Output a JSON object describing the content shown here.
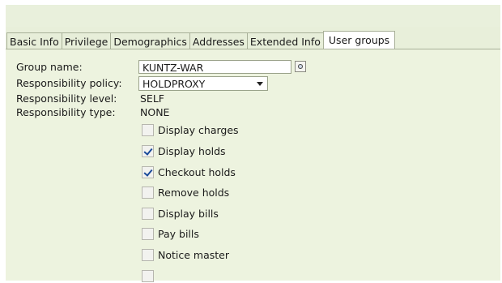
{
  "tabs": [
    {
      "label": "Basic Info",
      "active": false
    },
    {
      "label": "Privilege",
      "active": false
    },
    {
      "label": "Demographics",
      "active": false
    },
    {
      "label": "Addresses",
      "active": false
    },
    {
      "label": "Extended Info",
      "active": false
    },
    {
      "label": "User groups",
      "active": true
    }
  ],
  "form": {
    "group_name_label": "Group name:",
    "group_name_value": "KUNTZ-WAR",
    "policy_label": "Responsibility policy:",
    "policy_value": "HOLDPROXY",
    "level_label": "Responsibility level:",
    "level_value": "SELF",
    "type_label": "Responsibility type:",
    "type_value": "NONE"
  },
  "checkboxes": [
    {
      "label": "Display charges",
      "checked": false
    },
    {
      "label": "Display holds",
      "checked": true
    },
    {
      "label": "Checkout holds",
      "checked": true
    },
    {
      "label": "Remove holds",
      "checked": false
    },
    {
      "label": "Display bills",
      "checked": false
    },
    {
      "label": "Pay bills",
      "checked": false
    },
    {
      "label": "Notice master",
      "checked": false
    }
  ],
  "colors": {
    "panel": "#edf3df",
    "tab_bg": "#e7eed9",
    "check": "#1a4a9a"
  },
  "icons": {
    "lookup": "lookup-icon",
    "dropdown": "chevron-down-icon",
    "check": "check-icon"
  }
}
